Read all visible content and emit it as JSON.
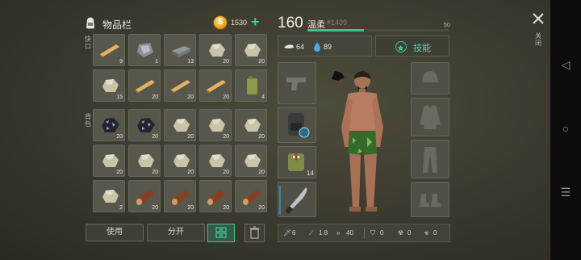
{
  "header": {
    "title": "物品栏",
    "coins": "1530",
    "add_label": "+"
  },
  "sections": {
    "quick_label": "快\n口",
    "backpack_label": "背\n包"
  },
  "quick_slots": [
    {
      "icon": "wooden-plank-icon",
      "count": "9"
    },
    {
      "icon": "metal-scrap-icon",
      "count": "1"
    },
    {
      "icon": "iron-bar-icon",
      "count": "13"
    },
    {
      "icon": "stone-icon",
      "count": "20"
    },
    {
      "icon": "stone-icon",
      "count": "20"
    },
    {
      "icon": "stone-icon",
      "count": "15"
    },
    {
      "icon": "wooden-plank-icon",
      "count": "20"
    },
    {
      "icon": "wooden-plank-icon",
      "count": "20"
    },
    {
      "icon": "wooden-plank-icon",
      "count": "20"
    },
    {
      "icon": "fuel-can-icon",
      "count": "4"
    }
  ],
  "backpack_slots": [
    {
      "icon": "coal-ore-icon",
      "count": "20"
    },
    {
      "icon": "coal-ore-icon",
      "count": "20"
    },
    {
      "icon": "stone-icon",
      "count": "20"
    },
    {
      "icon": "stone-icon",
      "count": "20"
    },
    {
      "icon": "stone-icon",
      "count": "20"
    },
    {
      "icon": "stone-icon",
      "count": "20"
    },
    {
      "icon": "stone-icon",
      "count": "20"
    },
    {
      "icon": "stone-icon",
      "count": "20"
    },
    {
      "icon": "stone-icon",
      "count": "20"
    },
    {
      "icon": "stone-icon",
      "count": "20"
    },
    {
      "icon": "stone-icon",
      "count": "2"
    },
    {
      "icon": "log-icon",
      "count": "20"
    },
    {
      "icon": "log-icon",
      "count": "20"
    },
    {
      "icon": "log-icon",
      "count": "20"
    },
    {
      "icon": "log-icon",
      "count": "20"
    }
  ],
  "buttons": {
    "use": "使用",
    "split": "分开"
  },
  "player": {
    "level": "160",
    "name": "温柔",
    "id": "#1409",
    "xp_max": "50",
    "xp_progress": 0.4,
    "food": "64",
    "water": "89",
    "skills_label": "技能"
  },
  "equipment": {
    "backpack_count": "",
    "medkit_count": "14"
  },
  "stats": {
    "damage": "6",
    "speed": "1.8",
    "run": "40",
    "armor": "0",
    "radiation": "0",
    "toxic": "0"
  },
  "close_label": "关闭",
  "colors": {
    "accent": "#3ec99c",
    "slot": "#57574b"
  }
}
